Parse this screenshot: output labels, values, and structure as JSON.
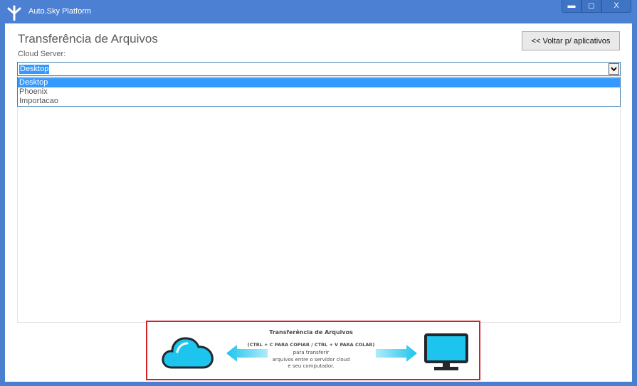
{
  "window": {
    "title": "Auto.Sky Platform",
    "controls": {
      "minimize": "▬",
      "maximize": "◻",
      "close": "X"
    }
  },
  "page": {
    "title": "Transferência de Arquivos",
    "back_button": "<< Voltar p/ aplicativos"
  },
  "cloud_server": {
    "label": "Cloud Server:",
    "selected": "Desktop",
    "options": [
      "Desktop",
      "Phoenix",
      "Importacao"
    ]
  },
  "banner": {
    "title": "Transferência de Arquivos",
    "shortcut": "(CTRL + C PARA COPIAR / CTRL + V PARA COLAR)",
    "line1": "para transferir",
    "line2": "arquivos entre o servidor cloud",
    "line3": "e seu computador.",
    "icons": [
      "cloud-icon",
      "arrow-left-icon",
      "arrow-right-icon",
      "monitor-icon"
    ]
  },
  "colors": {
    "titlebar": "#4b80d2",
    "selection": "#3399ff",
    "banner_border": "#d32027",
    "icon_blue": "#1cc4ee",
    "icon_dark": "#23282d"
  }
}
